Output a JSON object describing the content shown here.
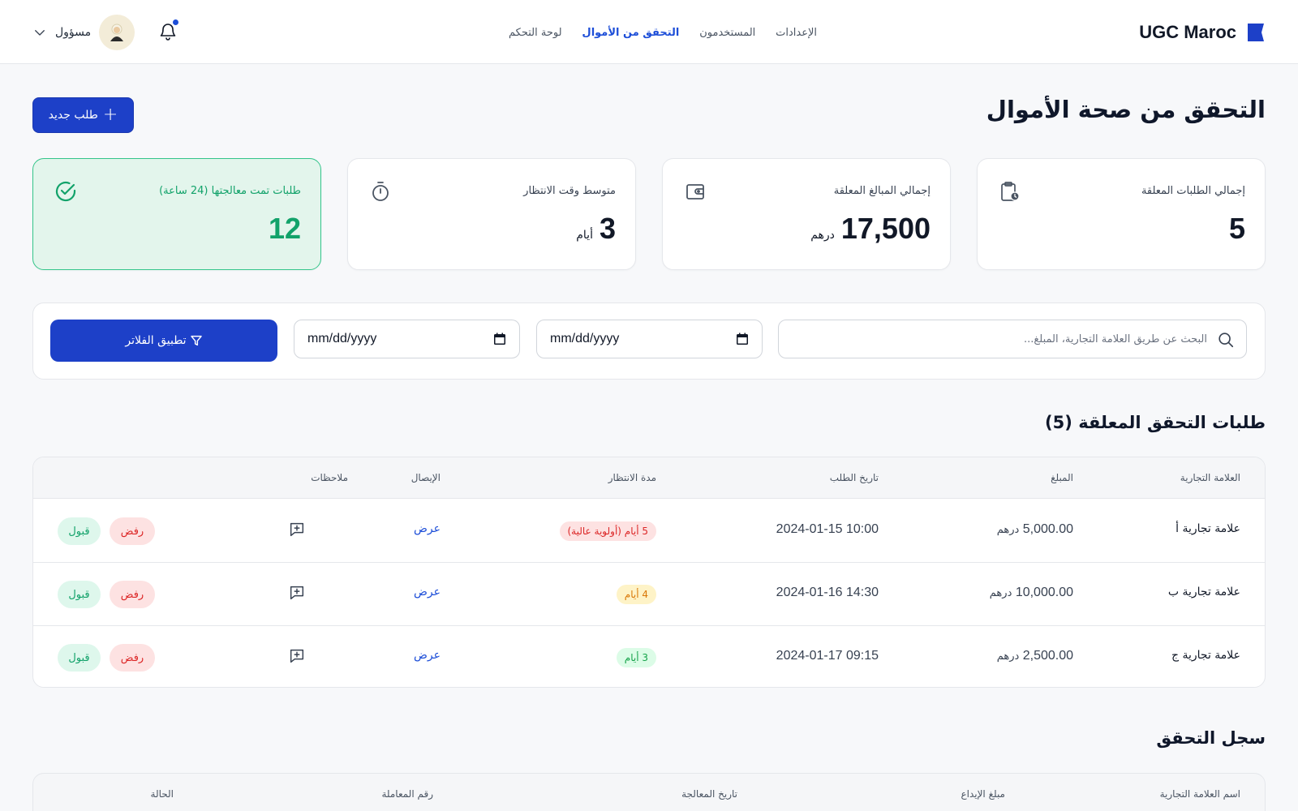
{
  "brand": {
    "name": "UGC Maroc",
    "logo_icon": "flag-logo-icon",
    "color": "#1d40c8"
  },
  "nav": {
    "items": [
      {
        "label": "لوحة التحكم",
        "active": false
      },
      {
        "label": "التحقق من الأموال",
        "active": true
      },
      {
        "label": "المستخدمون",
        "active": false
      },
      {
        "label": "الإعدادات",
        "active": false
      }
    ]
  },
  "user": {
    "name": "مسؤول",
    "has_notification": true
  },
  "header": {
    "title": "التحقق من صحة الأموال",
    "new_request_label": "طلب جديد"
  },
  "stats": [
    {
      "label": "إجمالي الطلبات المعلقة",
      "value": "5",
      "unit": "",
      "icon": "clipboard-clock-icon"
    },
    {
      "label": "إجمالي المبالغ المعلقة",
      "value": "17,500",
      "unit": "درهم",
      "icon": "wallet-icon"
    },
    {
      "label": "متوسط وقت الانتظار",
      "value": "3",
      "unit": "أيام",
      "icon": "stopwatch-icon"
    },
    {
      "label": "طلبات تمت معالجتها (24 ساعة)",
      "value": "12",
      "unit": "",
      "icon": "check-circle-icon",
      "highlight": "#12a26a"
    }
  ],
  "filters": {
    "search_placeholder": "البحث عن طريق العلامة التجارية، المبلغ...",
    "date_from": "mm/dd/yyyy",
    "date_to": "mm/dd/yyyy",
    "apply_label": "تطبيق الفلاتر"
  },
  "pending": {
    "title": "طلبات التحقق المعلقة (5)",
    "columns": [
      "العلامة التجارية",
      "المبلغ",
      "تاريخ الطلب",
      "مدة الانتظار",
      "الإيصال",
      "ملاحظات"
    ],
    "rows": [
      {
        "brand": "علامة تجارية أ",
        "amount": "5,000.00",
        "currency": "درهم",
        "date": "2024-01-15 10:00",
        "wait": "5 أيام (أولوية عالية)",
        "wait_level": "red",
        "receipt": "عرض",
        "reject": "رفض",
        "accept": "قبول"
      },
      {
        "brand": "علامة تجارية ب",
        "amount": "10,000.00",
        "currency": "درهم",
        "date": "2024-01-16 14:30",
        "wait": "4 أيام",
        "wait_level": "amber",
        "receipt": "عرض",
        "reject": "رفض",
        "accept": "قبول"
      },
      {
        "brand": "علامة تجارية ج",
        "amount": "2,500.00",
        "currency": "درهم",
        "date": "2024-01-17 09:15",
        "wait": "3 أيام",
        "wait_level": "green",
        "receipt": "عرض",
        "reject": "رفض",
        "accept": "قبول"
      }
    ]
  },
  "history": {
    "title": "سجل التحقق",
    "columns": [
      "اسم العلامة التجارية",
      "مبلغ الإيداع",
      "تاريخ المعالجة",
      "رقم المعاملة",
      "الحالة"
    ]
  }
}
